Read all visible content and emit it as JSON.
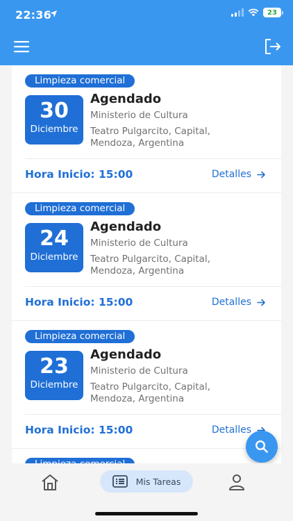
{
  "status_bar": {
    "time": "22:36",
    "battery": "23"
  },
  "colors": {
    "primary": "#3a97f0",
    "accent": "#1f6fd6",
    "nav_active_bg": "#d6e6fb"
  },
  "header": {
    "menu_icon": "hamburger-icon",
    "logout_icon": "logout-icon"
  },
  "tasks": [
    {
      "tag": "Limpieza comercial",
      "day": "30",
      "month": "Diciembre",
      "status": "Agendado",
      "org": "Ministerio de Cultura",
      "address_line1": "Teatro Pulgarcito, Capital,",
      "address_line2": "Mendoza, Argentina",
      "start_label": "Hora Inicio: 15:00",
      "details_label": "Detalles"
    },
    {
      "tag": "Limpieza comercial",
      "day": "24",
      "month": "Diciembre",
      "status": "Agendado",
      "org": "Ministerio de Cultura",
      "address_line1": "Teatro Pulgarcito, Capital,",
      "address_line2": "Mendoza, Argentina",
      "start_label": "Hora Inicio: 15:00",
      "details_label": "Detalles"
    },
    {
      "tag": "Limpieza comercial",
      "day": "23",
      "month": "Diciembre",
      "status": "Agendado",
      "org": "Ministerio de Cultura",
      "address_line1": "Teatro Pulgarcito, Capital,",
      "address_line2": "Mendoza, Argentina",
      "start_label": "Hora Inicio: 15:00",
      "details_label": "Detalles"
    },
    {
      "tag": "Limpieza comercial"
    }
  ],
  "fab": {
    "icon": "search-icon"
  },
  "bottom_nav": {
    "home_icon": "home-icon",
    "tasks_label": "Mis Tareas",
    "tasks_icon": "list-icon",
    "profile_icon": "profile-icon"
  }
}
